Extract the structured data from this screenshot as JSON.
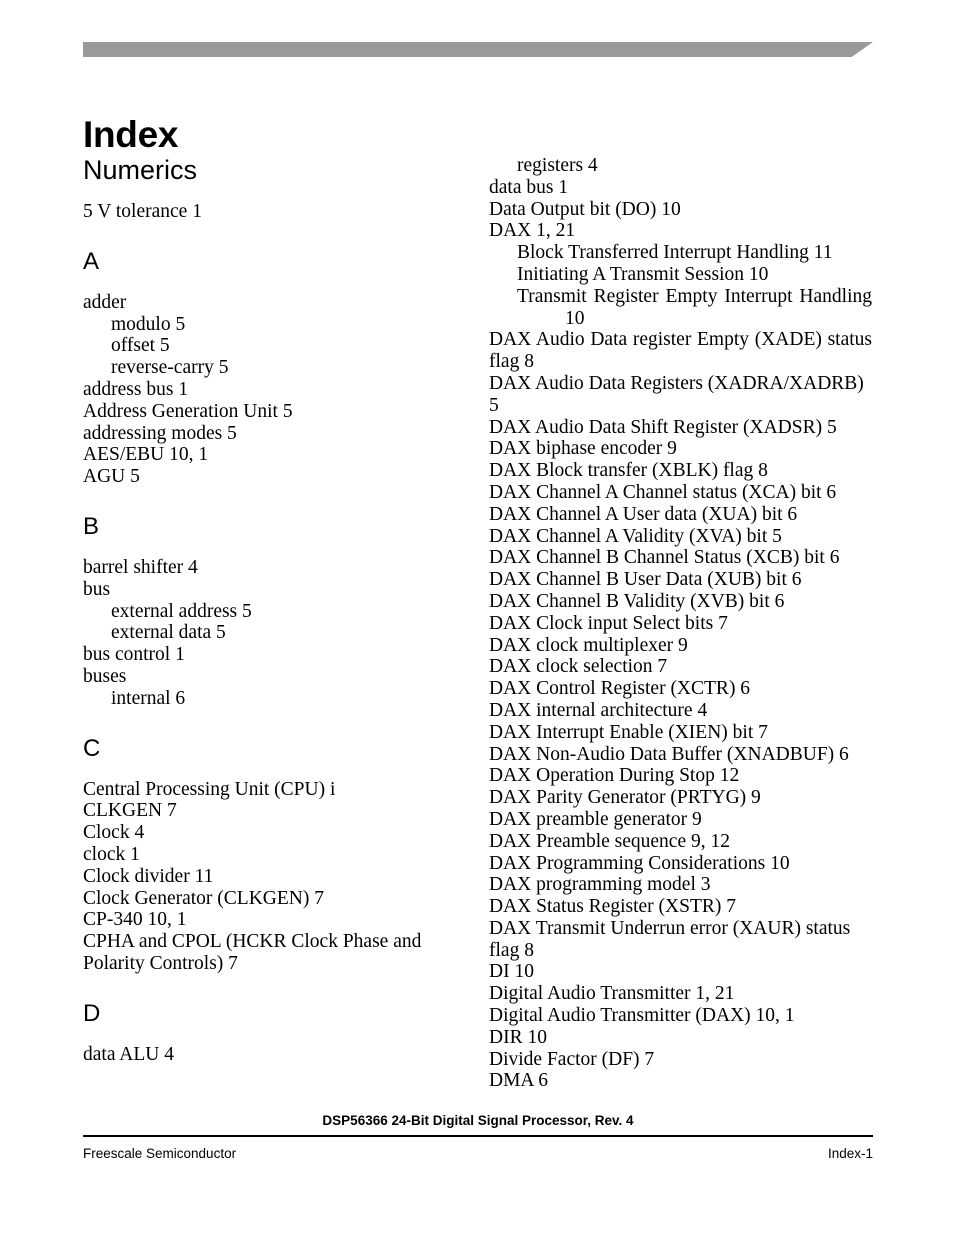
{
  "page": {
    "title": "Index",
    "accent_bar_color": "#9a9a9a"
  },
  "columns": {
    "left": {
      "sections": [
        {
          "heading": "Numerics",
          "heading_style": "word",
          "entries": [
            {
              "text": "5 V tolerance 1",
              "level": 0
            }
          ]
        },
        {
          "heading": "A",
          "heading_style": "letter",
          "entries": [
            {
              "text": "adder",
              "level": 0
            },
            {
              "text": "modulo 5",
              "level": 1
            },
            {
              "text": "offset 5",
              "level": 1
            },
            {
              "text": "reverse-carry 5",
              "level": 1
            },
            {
              "text": "address bus 1",
              "level": 0
            },
            {
              "text": "Address Generation Unit 5",
              "level": 0
            },
            {
              "text": "addressing modes 5",
              "level": 0
            },
            {
              "text": "AES/EBU 10, 1",
              "level": 0
            },
            {
              "text": "AGU 5",
              "level": 0
            }
          ]
        },
        {
          "heading": "B",
          "heading_style": "letter",
          "entries": [
            {
              "text": "barrel shifter 4",
              "level": 0
            },
            {
              "text": "bus",
              "level": 0
            },
            {
              "text": "external address 5",
              "level": 1
            },
            {
              "text": "external data 5",
              "level": 1
            },
            {
              "text": "bus control 1",
              "level": 0
            },
            {
              "text": "buses",
              "level": 0
            },
            {
              "text": "internal 6",
              "level": 1
            }
          ]
        },
        {
          "heading": "C",
          "heading_style": "letter",
          "entries": [
            {
              "text": "Central Processing Unit (CPU) i",
              "level": 0
            },
            {
              "text": "CLKGEN 7",
              "level": 0
            },
            {
              "text": "Clock 4",
              "level": 0
            },
            {
              "text": "clock 1",
              "level": 0
            },
            {
              "text": "Clock divider 11",
              "level": 0
            },
            {
              "text": "Clock Generator (CLKGEN) 7",
              "level": 0
            },
            {
              "text": "CP-340 10, 1",
              "level": 0
            },
            {
              "text": "CPHA and CPOL (HCKR Clock Phase and Polarity Controls) 7",
              "level": 0
            }
          ]
        },
        {
          "heading": "D",
          "heading_style": "letter",
          "entries": [
            {
              "text": "data ALU 4",
              "level": 0
            }
          ]
        }
      ]
    },
    "right": {
      "sections": [
        {
          "heading": "",
          "heading_style": "none",
          "entries": [
            {
              "text": "registers 4",
              "level": 1
            },
            {
              "text": "data bus 1",
              "level": 0
            },
            {
              "text": "Data Output bit (DO) 10",
              "level": 0
            },
            {
              "text": "DAX 1, 21",
              "level": 0
            },
            {
              "text": "Block Transferred Interrupt Handling 11",
              "level": 1
            },
            {
              "text": "Initiating A Transmit Session 10",
              "level": 1
            },
            {
              "text": "Transmit Register Empty Interrupt Handling 10",
              "level": 1,
              "justified": true
            },
            {
              "text": "DAX Audio Data register Empty (XADE) status flag 8",
              "level": 0,
              "justified": true
            },
            {
              "text": "DAX Audio Data Registers (XADRA/XADRB) 5",
              "level": 0
            },
            {
              "text": "DAX Audio Data Shift Register (XADSR) 5",
              "level": 0
            },
            {
              "text": "DAX biphase encoder 9",
              "level": 0
            },
            {
              "text": "DAX Block transfer (XBLK) flag 8",
              "level": 0
            },
            {
              "text": "DAX Channel A Channel status (XCA) bit 6",
              "level": 0
            },
            {
              "text": "DAX Channel A User data (XUA) bit 6",
              "level": 0
            },
            {
              "text": "DAX Channel A Validity (XVA) bit 5",
              "level": 0
            },
            {
              "text": "DAX Channel B Channel Status (XCB) bit 6",
              "level": 0
            },
            {
              "text": "DAX Channel B User Data (XUB) bit 6",
              "level": 0
            },
            {
              "text": "DAX Channel B Validity (XVB) bit 6",
              "level": 0
            },
            {
              "text": "DAX Clock input Select bits 7",
              "level": 0
            },
            {
              "text": "DAX clock multiplexer 9",
              "level": 0
            },
            {
              "text": "DAX clock selection 7",
              "level": 0
            },
            {
              "text": "DAX Control Register (XCTR) 6",
              "level": 0
            },
            {
              "text": "DAX internal architecture 4",
              "level": 0
            },
            {
              "text": "DAX Interrupt Enable (XIEN) bit 7",
              "level": 0
            },
            {
              "text": "DAX Non-Audio Data Buffer (XNADBUF) 6",
              "level": 0
            },
            {
              "text": "DAX Operation During Stop 12",
              "level": 0
            },
            {
              "text": "DAX Parity Generator (PRTYG) 9",
              "level": 0
            },
            {
              "text": "DAX preamble generator 9",
              "level": 0
            },
            {
              "text": "DAX Preamble sequence 9, 12",
              "level": 0
            },
            {
              "text": "DAX Programming Considerations 10",
              "level": 0
            },
            {
              "text": "DAX programming model 3",
              "level": 0
            },
            {
              "text": "DAX Status Register (XSTR) 7",
              "level": 0
            },
            {
              "text": "DAX Transmit Underrun error (XAUR) status flag 8",
              "level": 0
            },
            {
              "text": "DI 10",
              "level": 0
            },
            {
              "text": "Digital Audio Transmitter 1, 21",
              "level": 0
            },
            {
              "text": "Digital Audio Transmitter (DAX) 10, 1",
              "level": 0
            },
            {
              "text": "DIR 10",
              "level": 0
            },
            {
              "text": "Divide Factor (DF) 7",
              "level": 0
            },
            {
              "text": "DMA 6",
              "level": 0
            }
          ]
        }
      ]
    }
  },
  "footer": {
    "document": "DSP56366 24-Bit Digital Signal Processor, Rev. 4",
    "company": "Freescale Semiconductor",
    "page_number": "Index-1"
  }
}
